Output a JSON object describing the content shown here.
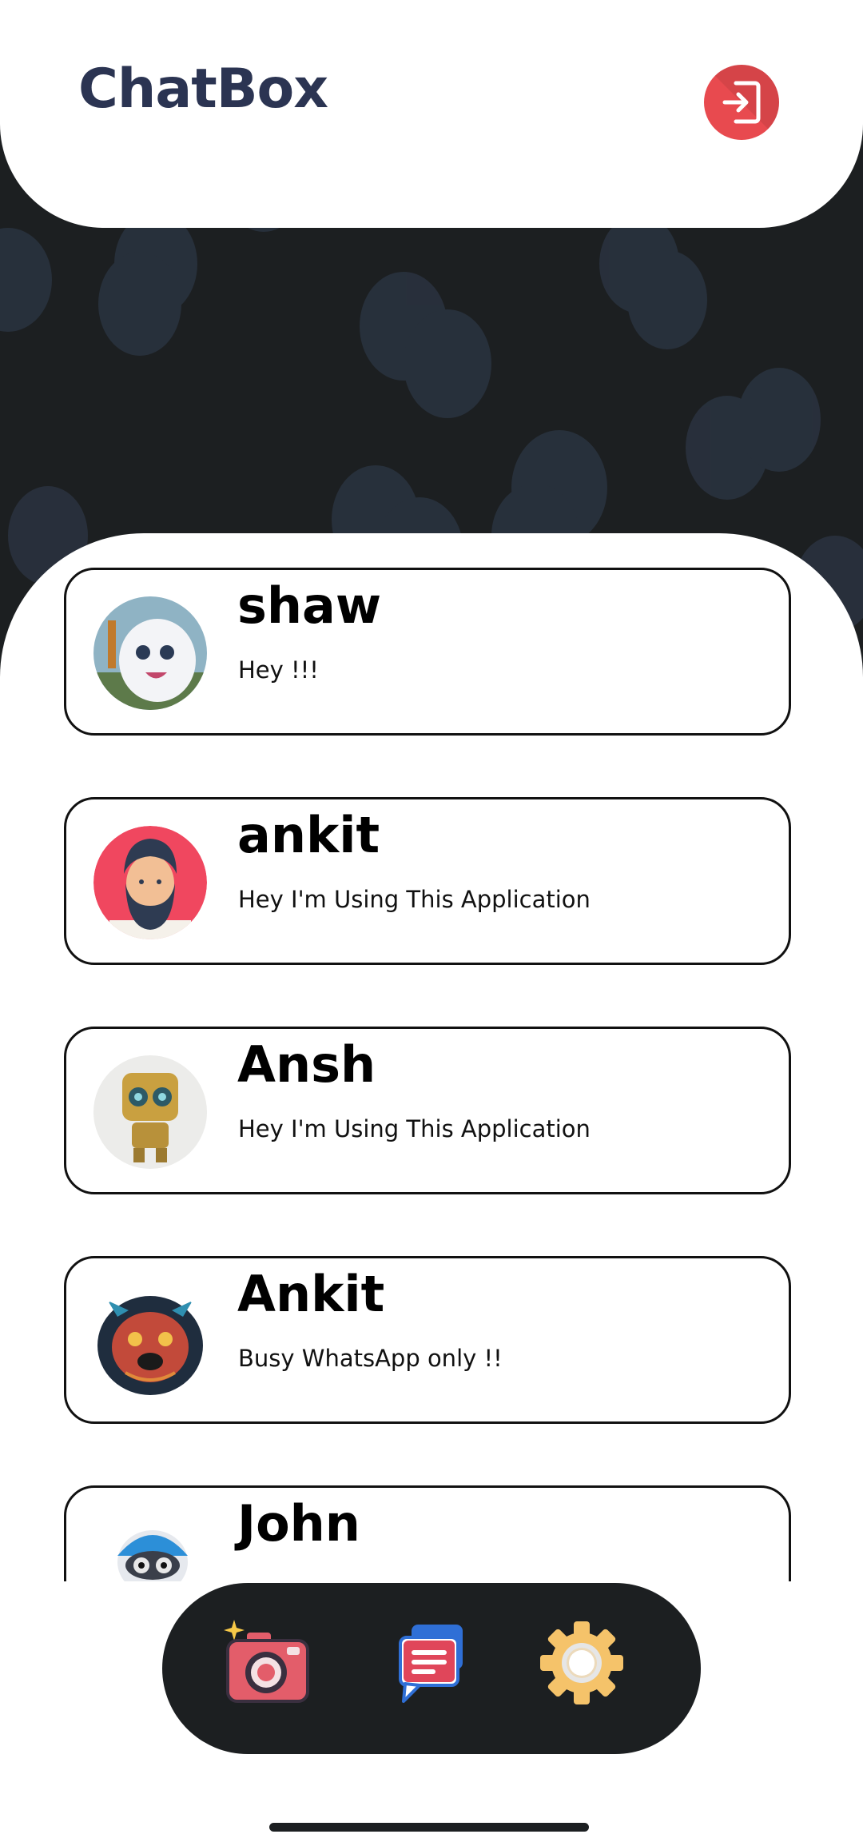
{
  "header": {
    "title": "ChatBox",
    "logout_icon": "logout-icon"
  },
  "colors": {
    "title": "#2b3452",
    "accent_red": "#e84a4f",
    "dark_bg": "#1c1f21"
  },
  "chats": [
    {
      "name": "shaw",
      "status": "Hey !!!",
      "avatar_icon": "white-cat-avatar"
    },
    {
      "name": "ankit",
      "status": "Hey I'm Using This Application",
      "avatar_icon": "bearded-man-avatar"
    },
    {
      "name": "Ansh",
      "status": "Hey I'm Using This Application",
      "avatar_icon": "robot-avatar"
    },
    {
      "name": "Ankit",
      "status": "Busy WhatsApp only !!",
      "avatar_icon": "dog-avatar"
    },
    {
      "name": "John",
      "status": "",
      "avatar_icon": "robot-pilot-avatar"
    }
  ],
  "nav": {
    "items": [
      {
        "icon": "camera-icon"
      },
      {
        "icon": "chat-icon"
      },
      {
        "icon": "settings-gear-icon"
      }
    ]
  }
}
